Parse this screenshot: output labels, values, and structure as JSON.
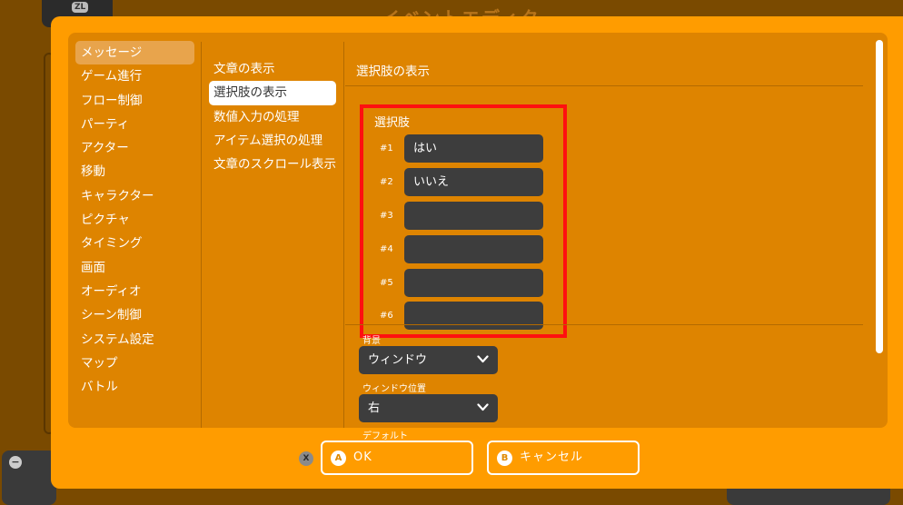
{
  "background": {
    "badge": "ZL",
    "title": "イベントエディタ"
  },
  "categories": [
    {
      "label": "メッセージ",
      "active": true
    },
    {
      "label": "ゲーム進行"
    },
    {
      "label": "フロー制御"
    },
    {
      "label": "パーティ"
    },
    {
      "label": "アクター"
    },
    {
      "label": "移動"
    },
    {
      "label": "キャラクター"
    },
    {
      "label": "ピクチャ"
    },
    {
      "label": "タイミング"
    },
    {
      "label": "画面"
    },
    {
      "label": "オーディオ"
    },
    {
      "label": "シーン制御"
    },
    {
      "label": "システム設定"
    },
    {
      "label": "マップ"
    },
    {
      "label": "バトル"
    }
  ],
  "commands": [
    {
      "label": "文章の表示"
    },
    {
      "label": "選択肢の表示",
      "active": true
    },
    {
      "label": "数値入力の処理"
    },
    {
      "label": "アイテム選択の処理"
    },
    {
      "label": "文章のスクロール表示"
    }
  ],
  "detail": {
    "title": "選択肢の表示",
    "choices_label": "選択肢",
    "choices": [
      {
        "num": "#1",
        "value": "はい"
      },
      {
        "num": "#2",
        "value": "いいえ"
      },
      {
        "num": "#3",
        "value": ""
      },
      {
        "num": "#4",
        "value": ""
      },
      {
        "num": "#5",
        "value": ""
      },
      {
        "num": "#6",
        "value": ""
      }
    ],
    "background_label": "背景",
    "background_value": "ウィンドウ",
    "position_label": "ウィンドウ位置",
    "position_value": "右",
    "default_label": "デフォルト"
  },
  "footer": {
    "x_key": "X",
    "ok_key": "A",
    "ok_label": "OK",
    "cancel_key": "B",
    "cancel_label": "キャンセル"
  },
  "colors": {
    "dialog_bg": "#ff9c00",
    "panel_bg": "#de8400",
    "highlight_box": "#ff1010",
    "input_bg": "#3d3d3d"
  }
}
